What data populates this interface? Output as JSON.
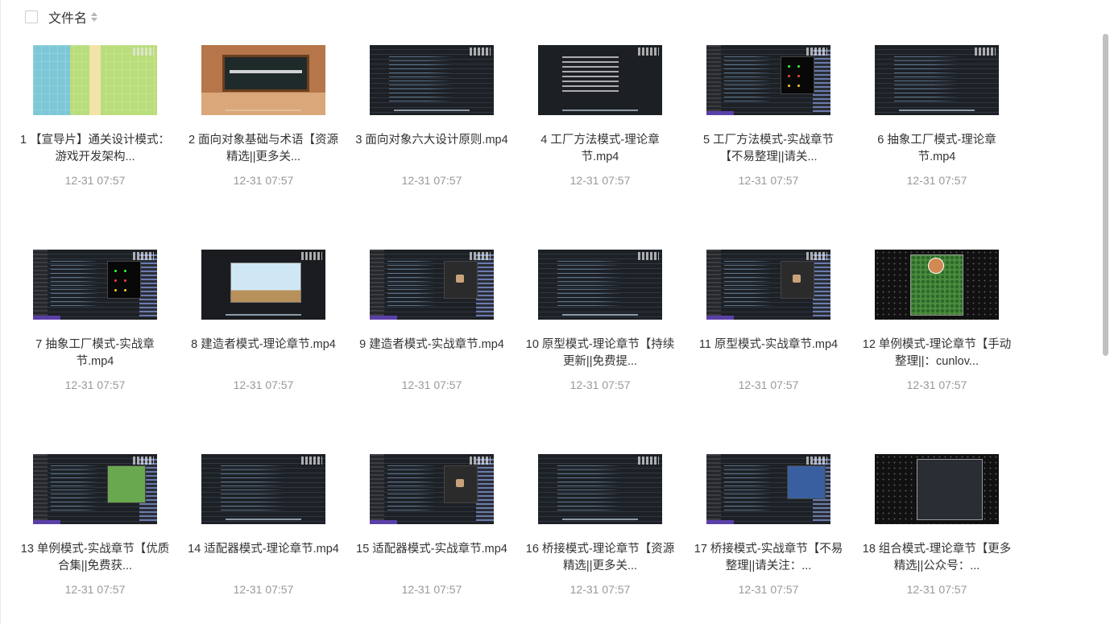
{
  "header": {
    "column_label": "文件名",
    "select_all_checked": false
  },
  "files": [
    {
      "title": "1 【宣导片】通关设计模式：游戏开发架构...",
      "date": "12-31 07:57",
      "thumb": "pixel"
    },
    {
      "title": "2 面向对象基础与术语【资源精选||更多关...",
      "date": "12-31 07:57",
      "thumb": "class"
    },
    {
      "title": "3 面向对象六大设计原则.mp4",
      "date": "12-31 07:57",
      "thumb": "code"
    },
    {
      "title": "4 工厂方法模式-理论章节.mp4",
      "date": "12-31 07:57",
      "thumb": "slides"
    },
    {
      "title": "5 工厂方法模式-实战章节【不易整理||请关...",
      "date": "12-31 07:57",
      "thumb": "ide"
    },
    {
      "title": "6 抽象工厂模式-理论章节.mp4",
      "date": "12-31 07:57",
      "thumb": "code"
    },
    {
      "title": "7 抽象工厂模式-实战章节.mp4",
      "date": "12-31 07:57",
      "thumb": "ide"
    },
    {
      "title": "8 建造者模式-理论章节.mp4",
      "date": "12-31 07:57",
      "thumb": "platform"
    },
    {
      "title": "9 建造者模式-实战章节.mp4",
      "date": "12-31 07:57",
      "thumb": "ide-game"
    },
    {
      "title": "10 原型模式-理论章节【持续更新||免费提...",
      "date": "12-31 07:57",
      "thumb": "code"
    },
    {
      "title": "11 原型模式-实战章节.mp4",
      "date": "12-31 07:57",
      "thumb": "ide-game"
    },
    {
      "title": "12 单例模式-理论章节【手动整理||：cunlov...",
      "date": "12-31 07:57",
      "thumb": "pixelfield"
    },
    {
      "title": "13 单例模式-实战章节【优质合集||免费获...",
      "date": "12-31 07:57",
      "thumb": "ide-map"
    },
    {
      "title": "14 适配器模式-理论章节.mp4",
      "date": "12-31 07:57",
      "thumb": "code"
    },
    {
      "title": "15 适配器模式-实战章节.mp4",
      "date": "12-31 07:57",
      "thumb": "ide-game"
    },
    {
      "title": "16 桥接模式-理论章节【资源精选||更多关...",
      "date": "12-31 07:57",
      "thumb": "code"
    },
    {
      "title": "17 桥接模式-实战章节【不易整理||请关注：...",
      "date": "12-31 07:57",
      "thumb": "ide-blue"
    },
    {
      "title": "18 组合模式-理论章节【更多精选||公众号：...",
      "date": "12-31 07:57",
      "thumb": "pixelfield-ui"
    }
  ],
  "colors": {
    "title_text": "#333333",
    "date_text": "#999999",
    "scroll_thumb": "#c1c1c1"
  }
}
